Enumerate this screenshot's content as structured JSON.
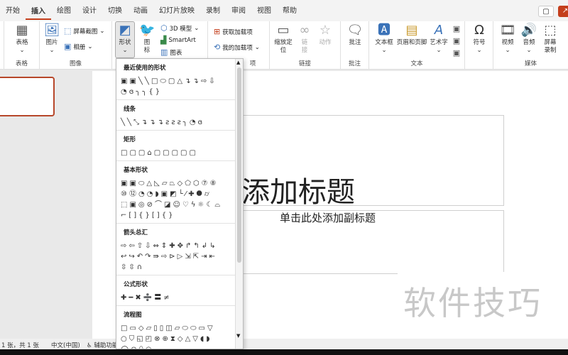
{
  "tabs": [
    "开始",
    "插入",
    "绘图",
    "设计",
    "切换",
    "动画",
    "幻灯片放映",
    "录制",
    "审阅",
    "视图",
    "帮助"
  ],
  "active_tab": "插入",
  "ribbon": {
    "table": {
      "label": "表格",
      "group": "表格"
    },
    "images": {
      "picture": "图片",
      "screenshot": "屏幕截图",
      "album": "相册",
      "group": "图像"
    },
    "illus": {
      "shapes": "形状",
      "icons": "图标",
      "model3d": "3D 模型",
      "smartart": "SmartArt",
      "chart": "图表"
    },
    "addins": {
      "get": "获取加载项",
      "mine": "我的加载项",
      "group": "项"
    },
    "links": {
      "zoom": "缩放定位",
      "link": "链接",
      "action": "动作",
      "group": "链接"
    },
    "comments": {
      "comment": "批注",
      "group": "批注"
    },
    "text": {
      "textbox": "文本框",
      "header": "页眉和页脚",
      "wordart": "艺术字",
      "group": "文本"
    },
    "symbols": {
      "symbol": "符号"
    },
    "media": {
      "video": "视频",
      "audio": "音频",
      "record": "屏幕录制",
      "group": "媒体"
    }
  },
  "shapes_menu": {
    "sections": [
      {
        "title": "最近使用的形状",
        "rows": [
          "▣▣╲╲□⬭▢△↴↴⇨⇩",
          "◔ɞ╮╮{}"
        ]
      },
      {
        "title": "线条",
        "rows": [
          "╲╲⤡↴↴↴ƨƨƨ╮◔ɞ"
        ]
      },
      {
        "title": "矩形",
        "rows": [
          "□▢▢⌂▢▢▢▢▢"
        ]
      },
      {
        "title": "基本形状",
        "rows": [
          "▣▣⬭△◺▱⏢◇⬠⬡⑦⑧",
          "⑩⑫◔◔◗▣◩└⁄✚⯃⌭",
          "⬚▣◎⊘⌒◪☺♡ϟ☼☾⌓",
          "⌐[]{}[]{}"
        ]
      },
      {
        "title": "箭头总汇",
        "rows": [
          "⇨⇦⇧⇩⇔⇕✚✥↱↰↲↳",
          "↩↪↶↷⇛⇨⊳▷⇲⇱⇥⇤",
          "⇳⇳∩"
        ]
      },
      {
        "title": "公式形状",
        "rows": [
          "✚━✖➗〓≠"
        ]
      },
      {
        "title": "流程图",
        "rows": [
          "□▭◇▱▯▯◫▱⬭⬭▭▽",
          "○⛉◱◰⊗⊕⧗◇△▽◖◗",
          "◯⊖⬯○"
        ]
      }
    ]
  },
  "slide": {
    "title": "单击此处添加标题",
    "subtitle": "单击此处添加副标题"
  },
  "watermark": "软件技巧",
  "status": {
    "slide": "1 张，共 1 张",
    "lang": "中文(中国)",
    "access": "辅助功能"
  }
}
